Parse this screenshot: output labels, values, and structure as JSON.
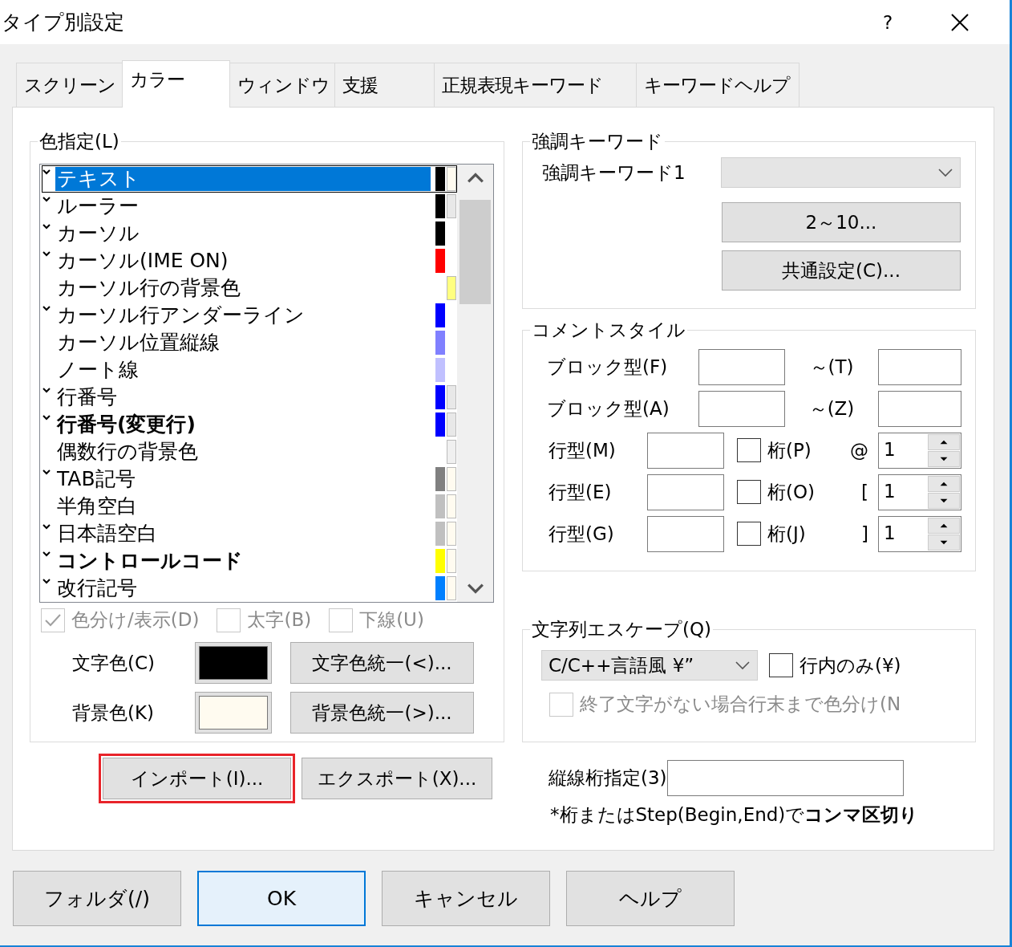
{
  "window": {
    "title": "タイプ別設定",
    "help": "?"
  },
  "tabs": [
    {
      "label": "スクリーン",
      "selected": false
    },
    {
      "label": "カラー",
      "selected": true
    },
    {
      "label": "ウィンドウ",
      "selected": false
    },
    {
      "label": "支援",
      "selected": false
    },
    {
      "label": "正規表現キーワード",
      "selected": false
    },
    {
      "label": "キーワードヘルプ",
      "selected": false
    }
  ],
  "color_group": {
    "title": "色指定(L)",
    "items": [
      {
        "label": "テキスト",
        "marked": true,
        "bold": false,
        "selected": true,
        "swatches": [
          {
            "kind": "text",
            "color": "#000000"
          },
          {
            "kind": "background",
            "color": "#fffbf0"
          }
        ]
      },
      {
        "label": "ルーラー",
        "marked": true,
        "bold": false,
        "selected": false,
        "swatches": [
          {
            "kind": "text",
            "color": "#000000"
          },
          {
            "kind": "background",
            "color": "#e8e8e8"
          }
        ]
      },
      {
        "label": "カーソル",
        "marked": true,
        "bold": false,
        "selected": false,
        "swatches": [
          {
            "kind": "text",
            "color": "#000000"
          }
        ]
      },
      {
        "label": "カーソル(IME ON)",
        "marked": true,
        "bold": false,
        "selected": false,
        "swatches": [
          {
            "kind": "text",
            "color": "#ff0000"
          }
        ]
      },
      {
        "label": "カーソル行の背景色",
        "marked": false,
        "bold": false,
        "selected": false,
        "swatches": [
          {
            "kind": "background",
            "color": "#ffff80"
          }
        ]
      },
      {
        "label": "カーソル行アンダーライン",
        "marked": true,
        "bold": false,
        "selected": false,
        "swatches": [
          {
            "kind": "text",
            "color": "#0000ff"
          }
        ]
      },
      {
        "label": "カーソル位置縦線",
        "marked": false,
        "bold": false,
        "selected": false,
        "swatches": [
          {
            "kind": "text",
            "color": "#8080ff"
          }
        ]
      },
      {
        "label": "ノート線",
        "marked": false,
        "bold": false,
        "selected": false,
        "swatches": [
          {
            "kind": "text",
            "color": "#c0c0ff"
          }
        ]
      },
      {
        "label": "行番号",
        "marked": true,
        "bold": false,
        "selected": false,
        "swatches": [
          {
            "kind": "text",
            "color": "#0000ff"
          },
          {
            "kind": "background",
            "color": "#e8e8e8"
          }
        ]
      },
      {
        "label": "行番号(変更行)",
        "marked": true,
        "bold": true,
        "selected": false,
        "swatches": [
          {
            "kind": "text",
            "color": "#0000ff"
          },
          {
            "kind": "background",
            "color": "#e8e8e8"
          }
        ]
      },
      {
        "label": "偶数行の背景色",
        "marked": false,
        "bold": false,
        "selected": false,
        "swatches": [
          {
            "kind": "background",
            "color": "#f0f0f0"
          }
        ]
      },
      {
        "label": "TAB記号",
        "marked": true,
        "bold": false,
        "selected": false,
        "swatches": [
          {
            "kind": "text",
            "color": "#808080"
          },
          {
            "kind": "background",
            "color": "#fffbf0"
          }
        ]
      },
      {
        "label": "半角空白",
        "marked": false,
        "bold": false,
        "selected": false,
        "swatches": [
          {
            "kind": "text",
            "color": "#c0c0c0"
          },
          {
            "kind": "background",
            "color": "#fffbf0"
          }
        ]
      },
      {
        "label": "日本語空白",
        "marked": true,
        "bold": false,
        "selected": false,
        "swatches": [
          {
            "kind": "text",
            "color": "#c0c0c0"
          },
          {
            "kind": "background",
            "color": "#fffbf0"
          }
        ]
      },
      {
        "label": "コントロールコード",
        "marked": true,
        "bold": true,
        "selected": false,
        "swatches": [
          {
            "kind": "text",
            "color": "#ffff00"
          },
          {
            "kind": "background",
            "color": "#fffbf0"
          }
        ]
      },
      {
        "label": "改行記号",
        "marked": true,
        "bold": false,
        "selected": false,
        "swatches": [
          {
            "kind": "text",
            "color": "#0080ff"
          },
          {
            "kind": "background",
            "color": "#fffbf0"
          }
        ]
      }
    ],
    "options": [
      {
        "label": "色分け/表示(D)",
        "checked": true,
        "disabled": true
      },
      {
        "label": "太字(B)",
        "checked": false,
        "disabled": true
      },
      {
        "label": "下線(U)",
        "checked": false,
        "disabled": true
      }
    ],
    "colors": [
      {
        "label": "文字色(C)",
        "color": "#000000",
        "button": "文字色統一(<)..."
      },
      {
        "label": "背景色(K)",
        "color": "#fffbf0",
        "button": "背景色統一(>)..."
      }
    ]
  },
  "import_button": {
    "label": "インポート(I)...",
    "highlighted": true
  },
  "export_button": {
    "label": "エクスポート(X)...",
    "highlighted": false
  },
  "keyword_group": {
    "title": "強調キーワード",
    "label": "強調キーワード1",
    "buttons": [
      "2～10...",
      "共通設定(C)..."
    ]
  },
  "comment_group": {
    "title": "コメントスタイル",
    "block_rows": [
      {
        "label": "ブロック型(F)",
        "end_label": "～(T)"
      },
      {
        "label": "ブロック型(A)",
        "end_label": "～(Z)"
      }
    ],
    "line_rows": [
      {
        "label": "行型(M)",
        "check_label": "桁(P)",
        "checked": false,
        "prefix": "@",
        "value": "1"
      },
      {
        "label": "行型(E)",
        "check_label": "桁(O)",
        "checked": false,
        "prefix": "[",
        "value": "1"
      },
      {
        "label": "行型(G)",
        "check_label": "桁(J)",
        "checked": false,
        "prefix": "]",
        "value": "1"
      }
    ]
  },
  "escape_group": {
    "title": "文字列エスケープ(Q)",
    "select": "C/C++言語風 ¥”",
    "checks": [
      {
        "label": "行内のみ(¥)",
        "checked": false,
        "disabled": false
      },
      {
        "label": "終了文字がない場合行末まで色分け(N",
        "checked": false,
        "disabled": true
      }
    ]
  },
  "vertical_lines": {
    "label": "縦線桁指定(3)",
    "note": "*桁またはStep(Begin,End)で**コンマ区切り**"
  },
  "footer_buttons": [
    {
      "label": "フォルダ(/)",
      "default": false
    },
    {
      "label": "OK",
      "default": true
    },
    {
      "label": "キャンセル",
      "default": false
    },
    {
      "label": "ヘルプ",
      "default": false
    }
  ]
}
